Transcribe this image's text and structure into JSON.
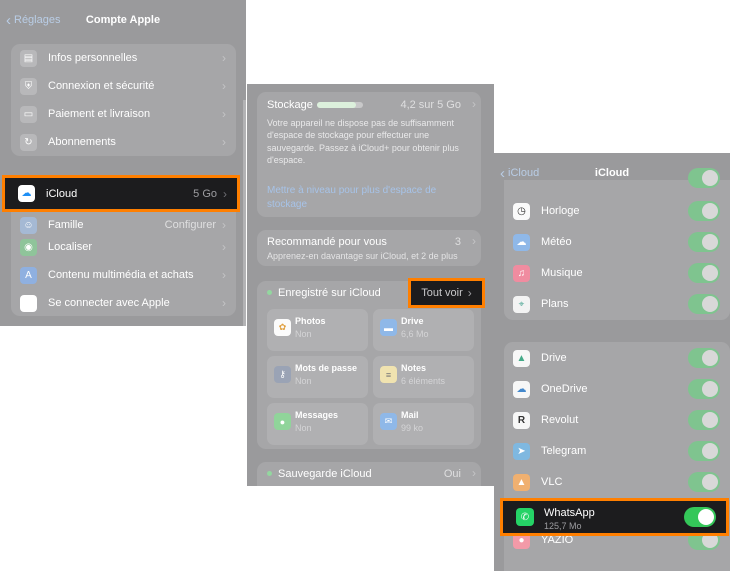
{
  "panel1": {
    "back": "Réglages",
    "title": "Compte Apple",
    "group1": [
      {
        "label": "Infos personnelles",
        "icon": "person-card-icon"
      },
      {
        "label": "Connexion et sécurité",
        "icon": "shield-icon"
      },
      {
        "label": "Paiement et livraison",
        "icon": "credit-card-icon"
      },
      {
        "label": "Abonnements",
        "icon": "subscriptions-icon"
      }
    ],
    "icloud": {
      "label": "iCloud",
      "value": "5 Go"
    },
    "family": {
      "label": "Famille",
      "value": "Configurer"
    },
    "group2": [
      {
        "label": "Localiser",
        "icon": "find-my-icon"
      },
      {
        "label": "Contenu multimédia et achats",
        "icon": "app-store-icon"
      },
      {
        "label": "Se connecter avec Apple",
        "icon": "apple-icon"
      }
    ]
  },
  "panel2": {
    "storage": {
      "title": "Stockage",
      "amount": "4,2 sur 5 Go",
      "fill": 0.84,
      "message": "Votre appareil ne dispose pas de suffisamment d'espace de stockage pour effectuer une sauvegarde. Passez à iCloud+ pour obtenir plus d'espace.",
      "upgrade": "Mettre à niveau pour plus d'espace de stockage"
    },
    "recommended": {
      "title": "Recommandé pour vous",
      "count": "3",
      "subtitle": "Apprenez-en davantage sur iCloud, et 2 de plus"
    },
    "saved": {
      "title": "Enregistré sur iCloud",
      "see_all": "Tout voir"
    },
    "tiles": [
      {
        "name": "Photos",
        "sub": "Non",
        "icon": "photos-icon"
      },
      {
        "name": "Drive",
        "sub": "6,6 Mo",
        "icon": "folder-icon"
      },
      {
        "name": "Mots de passe",
        "sub": "Non",
        "icon": "key-icon"
      },
      {
        "name": "Notes",
        "sub": "6 éléments",
        "icon": "notes-icon"
      },
      {
        "name": "Messages",
        "sub": "Non",
        "icon": "messages-icon"
      },
      {
        "name": "Mail",
        "sub": "99 ko",
        "icon": "mail-icon"
      }
    ],
    "backup": {
      "title": "Sauvegarde iCloud",
      "value": "Oui"
    }
  },
  "panel3": {
    "back": "iCloud",
    "title": "iCloud",
    "apps1": [
      {
        "label": "Horloge",
        "icon": "clock-icon"
      },
      {
        "label": "Météo",
        "icon": "weather-icon"
      },
      {
        "label": "Musique",
        "icon": "music-icon"
      },
      {
        "label": "Plans",
        "icon": "maps-icon"
      }
    ],
    "apps2": [
      {
        "label": "Drive",
        "icon": "google-drive-icon"
      },
      {
        "label": "OneDrive",
        "icon": "onedrive-icon"
      },
      {
        "label": "Revolut",
        "icon": "revolut-icon"
      },
      {
        "label": "Telegram",
        "icon": "telegram-icon"
      },
      {
        "label": "VLC",
        "icon": "vlc-icon"
      }
    ],
    "whatsapp": {
      "label": "WhatsApp",
      "size": "125,7 Mo"
    },
    "yazio": {
      "label": "YAZIO"
    }
  },
  "colors": {
    "highlight": "#ff7f00",
    "toggle_on": "#34c759",
    "link": "#b9cde6"
  }
}
